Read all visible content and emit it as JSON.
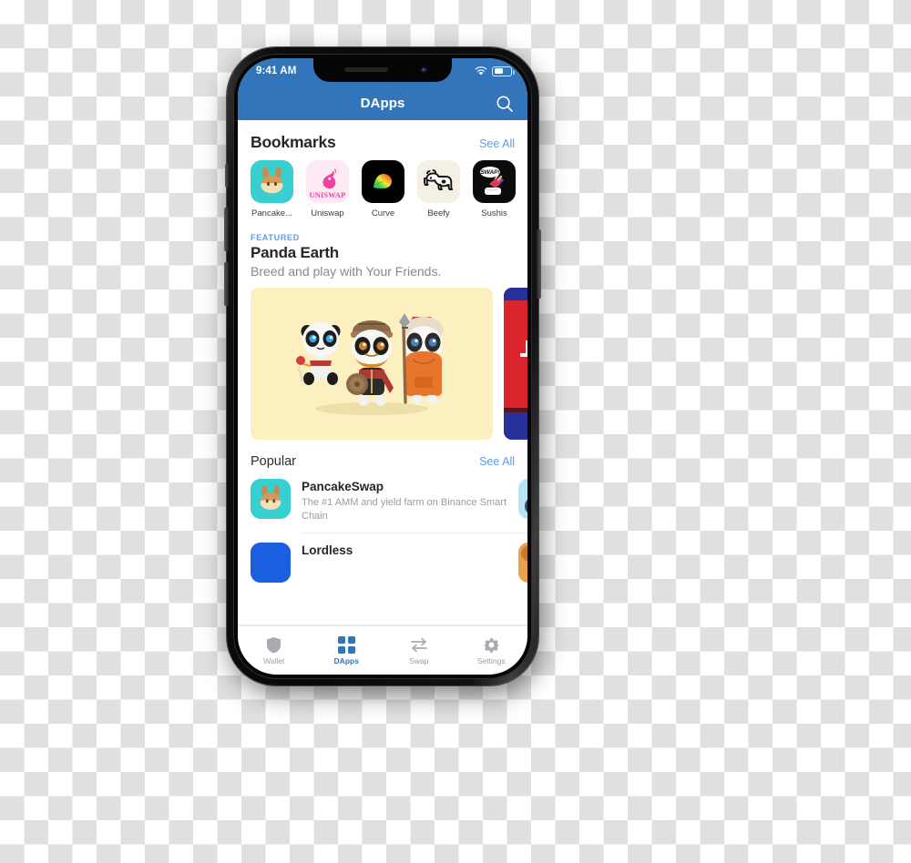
{
  "status_bar": {
    "time": "9:41 AM",
    "wifi_icon": "wifi-icon",
    "battery_icon": "battery-icon",
    "battery_level": "50%"
  },
  "nav": {
    "title": "DApps",
    "search_icon": "search-icon"
  },
  "bookmarks": {
    "title": "Bookmarks",
    "see_all": "See All",
    "items": [
      {
        "label": "Pancake...",
        "icon": "pancakeswap-icon"
      },
      {
        "label": "Uniswap",
        "icon": "uniswap-icon"
      },
      {
        "label": "Curve",
        "icon": "curve-icon"
      },
      {
        "label": "Beefy",
        "icon": "beefy-icon"
      },
      {
        "label": "Sushis",
        "icon": "sushiswap-icon"
      }
    ]
  },
  "featured": {
    "kicker": "FEATURED",
    "title": "Panda Earth",
    "subtitle": "Breed and play with Your Friends.",
    "banner_alt": "three-panda-characters-illustration"
  },
  "popular": {
    "title": "Popular",
    "see_all": "See All",
    "items": [
      {
        "name": "PancakeSwap",
        "description": "The #1 AMM and yield farm on Binance Smart Chain",
        "icon": "pancakeswap-icon"
      },
      {
        "name": "Lordless",
        "description": "",
        "icon": "lordless-icon"
      }
    ]
  },
  "tab_bar": {
    "items": [
      {
        "label": "Wallet",
        "icon": "shield-icon",
        "active": false
      },
      {
        "label": "DApps",
        "icon": "grid-icon",
        "active": true
      },
      {
        "label": "Swap",
        "icon": "swap-arrows-icon",
        "active": false
      },
      {
        "label": "Settings",
        "icon": "gear-icon",
        "active": false
      }
    ]
  },
  "colors": {
    "brand_blue": "#3375BB",
    "link_blue": "#5d9cec",
    "banner_bg": "#FCF0C0"
  }
}
